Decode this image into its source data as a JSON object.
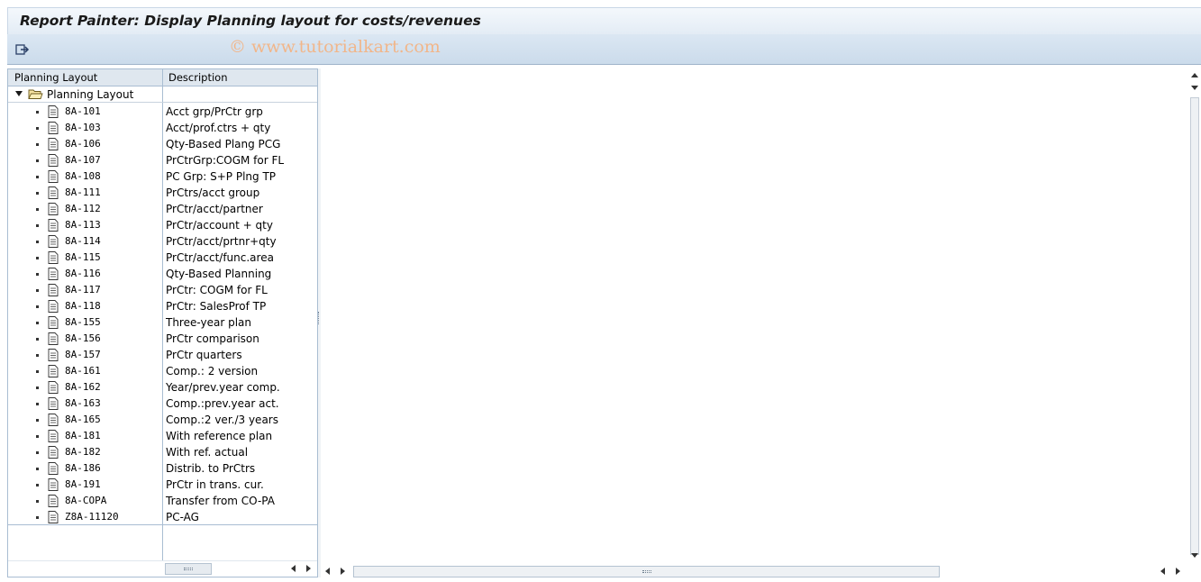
{
  "window": {
    "title": "Report Painter: Display Planning layout for costs/revenues"
  },
  "toolbar": {
    "execute_icon": "execute-arrow-icon",
    "watermark": "© www.tutorialkart.com"
  },
  "tree": {
    "columns": [
      "Planning Layout",
      "Description"
    ],
    "root": {
      "label": "Planning Layout",
      "icon": "folder-open-icon"
    },
    "rows": [
      {
        "code": "8A-101",
        "desc": "Acct grp/PrCtr grp"
      },
      {
        "code": "8A-103",
        "desc": "Acct/prof.ctrs + qty"
      },
      {
        "code": "8A-106",
        "desc": "Qty-Based Plang PCG"
      },
      {
        "code": "8A-107",
        "desc": "PrCtrGrp:COGM for FL"
      },
      {
        "code": "8A-108",
        "desc": "PC Grp: S+P Plng TP"
      },
      {
        "code": "8A-111",
        "desc": "PrCtrs/acct group"
      },
      {
        "code": "8A-112",
        "desc": "PrCtr/acct/partner"
      },
      {
        "code": "8A-113",
        "desc": "PrCtr/account + qty"
      },
      {
        "code": "8A-114",
        "desc": "PrCtr/acct/prtnr+qty"
      },
      {
        "code": "8A-115",
        "desc": "PrCtr/acct/func.area"
      },
      {
        "code": "8A-116",
        "desc": "Qty-Based Planning"
      },
      {
        "code": "8A-117",
        "desc": "PrCtr: COGM for FL"
      },
      {
        "code": "8A-118",
        "desc": "PrCtr: SalesProf TP"
      },
      {
        "code": "8A-155",
        "desc": "Three-year plan"
      },
      {
        "code": "8A-156",
        "desc": "PrCtr comparison"
      },
      {
        "code": "8A-157",
        "desc": "PrCtr quarters"
      },
      {
        "code": "8A-161",
        "desc": "Comp.: 2 version"
      },
      {
        "code": "8A-162",
        "desc": "Year/prev.year comp."
      },
      {
        "code": "8A-163",
        "desc": "Comp.:prev.year act."
      },
      {
        "code": "8A-165",
        "desc": "Comp.:2 ver./3 years"
      },
      {
        "code": "8A-181",
        "desc": "With reference plan"
      },
      {
        "code": "8A-182",
        "desc": "With ref. actual"
      },
      {
        "code": "8A-186",
        "desc": "Distrib. to PrCtrs"
      },
      {
        "code": "8A-191",
        "desc": "PrCtr in trans. cur."
      },
      {
        "code": "8A-COPA",
        "desc": "Transfer from CO-PA"
      },
      {
        "code": "Z8A-11120",
        "desc": "PC-AG"
      }
    ]
  },
  "colors": {
    "title_bar": "#e3ecf5",
    "toolbar": "#cbdbeb",
    "watermark": "#f1b68a",
    "border": "#a9bdd2"
  }
}
